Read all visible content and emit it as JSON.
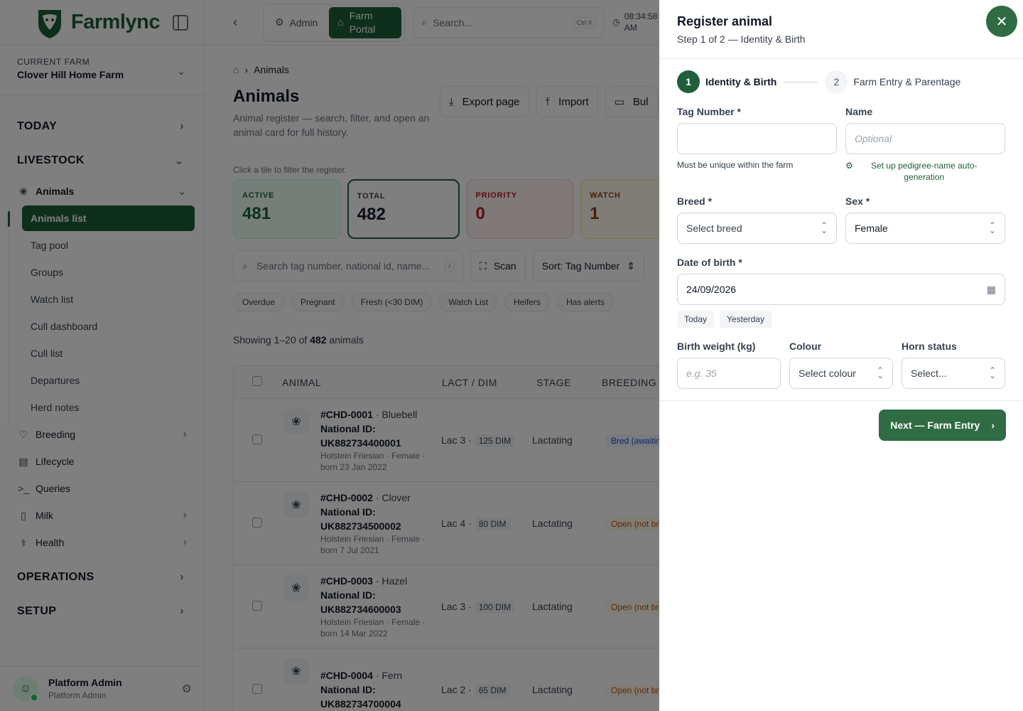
{
  "app": {
    "name": "Farmlync"
  },
  "sidebar": {
    "farm_label": "CURRENT FARM",
    "farm_name": "Clover Hill Home Farm",
    "sections": {
      "today": "TODAY",
      "livestock": "LIVESTOCK",
      "operations": "OPERATIONS",
      "setup": "SETUP"
    },
    "animals_label": "Animals",
    "animal_items": [
      "Animals list",
      "Tag pool",
      "Groups",
      "Watch list",
      "Cull dashboard",
      "Cull list",
      "Departures",
      "Herd notes"
    ],
    "groups": {
      "breeding": "Breeding",
      "lifecycle": "Lifecycle",
      "queries": "Queries",
      "milk": "Milk",
      "health": "Health"
    },
    "user": {
      "name": "Platform Admin",
      "role": "Platform Admin"
    }
  },
  "topbar": {
    "admin_tab": "Admin",
    "portal_tab": "Farm Portal",
    "search_placeholder": "Search...",
    "search_shortcut": "Ctrl K",
    "time": "08:34:58",
    "ampm": "AM"
  },
  "main": {
    "breadcrumb": "Animals",
    "title": "Animals",
    "subtitle": "Animal register — search, filter, and open an animal card for full history.",
    "actions": {
      "export": "Export page",
      "import": "Import",
      "bulk": "Bul"
    },
    "hint": "Click a tile to filter the register.",
    "tiles": [
      {
        "label": "ACTIVE",
        "value": "481"
      },
      {
        "label": "TOTAL",
        "value": "482"
      },
      {
        "label": "PRIORITY",
        "value": "0"
      },
      {
        "label": "WATCH",
        "value": "1"
      }
    ],
    "search_placeholder": "Search tag number, national id, name...",
    "search_key": "/",
    "scan": "Scan",
    "sort": "Sort: Tag Number",
    "chips": [
      "Overdue",
      "Pregnant",
      "Fresh (<30 DIM)",
      "Watch List",
      "Heifers",
      "Has alerts"
    ],
    "showing_prefix": "Showing 1–20 of",
    "showing_count": "482",
    "showing_suffix": "animals",
    "columns": {
      "animal": "ANIMAL",
      "lact": "LACT / DIM",
      "stage": "STAGE",
      "breeding": "BREEDING"
    },
    "rows": [
      {
        "tag": "#CHD-0001",
        "name": "· Bluebell",
        "nid_label": "National ID:",
        "nid": "UK882734400001",
        "meta": "Holstein Friesian · Female · born 23 Jan 2022",
        "lact": "Lac 3 ·",
        "dim": "125 DIM",
        "stage": "Lactating",
        "breeding": "Bred (awaitin"
      },
      {
        "tag": "#CHD-0002",
        "name": "· Clover",
        "nid_label": "National ID:",
        "nid": "UK882734500002",
        "meta": "Holstein Friesian · Female · born 7 Jul 2021",
        "lact": "Lac 4 ·",
        "dim": "80 DIM",
        "stage": "Lactating",
        "breeding": "Open (not br"
      },
      {
        "tag": "#CHD-0003",
        "name": "· Hazel",
        "nid_label": "National ID:",
        "nid": "UK882734600003",
        "meta": "Holstein Friesian · Female · born 14 Mar 2022",
        "lact": "Lac 3 ·",
        "dim": "100 DIM",
        "stage": "Lactating",
        "breeding": "Open (not br"
      },
      {
        "tag": "#CHD-0004",
        "name": "· Fern",
        "nid_label": "National ID:",
        "nid": "UK882734700004",
        "meta": "",
        "lact": "Lac 2 ·",
        "dim": "65 DIM",
        "stage": "Lactating",
        "breeding": "Open (not br"
      }
    ]
  },
  "drawer": {
    "title": "Register animal",
    "subtitle": "Step 1 of 2 — Identity & Birth",
    "steps": [
      {
        "num": "1",
        "label": "Identity & Birth"
      },
      {
        "num": "2",
        "label": "Farm Entry & Parentage"
      }
    ],
    "tag_label": "Tag Number *",
    "tag_value": "",
    "tag_help": "Must be unique within the farm",
    "name_label": "Name",
    "name_placeholder": "Optional",
    "pedigree_link": "Set up pedigree-name auto-generation",
    "breed_label": "Breed *",
    "breed_value": "Select breed",
    "sex_label": "Sex *",
    "sex_value": "Female",
    "dob_label": "Date of birth *",
    "dob_value": "24/09/2026",
    "quick_today": "Today",
    "quick_yesterday": "Yesterday",
    "weight_label": "Birth weight (kg)",
    "weight_placeholder": "e.g. 35",
    "colour_label": "Colour",
    "colour_value": "Select colour",
    "horn_label": "Horn status",
    "horn_value": "Select...",
    "next_button": "Next — Farm Entry"
  },
  "colors": {
    "brand": "#1f5f3b",
    "accent": "#2f6b43"
  }
}
